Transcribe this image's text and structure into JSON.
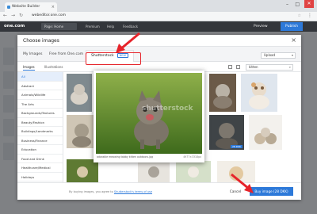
{
  "browser": {
    "tab_title": "Website Builder",
    "tab_close": "×",
    "url": "webeditor.one.com",
    "win_min": "–",
    "win_max": "□",
    "win_close": "✕",
    "back": "←",
    "forward": "→",
    "reload": "↻",
    "star": "☆",
    "menu": "⋮"
  },
  "appbar": {
    "logo": "one.com",
    "page": "Page: Home",
    "premium": "Premium",
    "help": "Help",
    "feedback": "Feedback",
    "preview": "Preview",
    "publish": "Publish"
  },
  "modal": {
    "title": "Choose images",
    "close": "×",
    "source_tabs": [
      "My Images",
      "Free from One.com",
      "Shutterstock"
    ],
    "new_badge": "NEW",
    "upload_select": "Upload",
    "sub_tabs": [
      "Images",
      "Illustrations"
    ],
    "search_value": "kitten",
    "search_icon": "⌕",
    "categories": [
      "All",
      "Abstract",
      "Animals/Wildlife",
      "The Arts",
      "Backgrounds/Textures",
      "Beauty/Fashion",
      "Buildings/Landmarks",
      "Business/Finance",
      "Education",
      "Food and Drink",
      "Healthcare/Medical",
      "Holidays"
    ],
    "active_category": "All",
    "price_badge": "28 DKK",
    "preview": {
      "watermark": "shutterstock",
      "caption": "adorable meowing tabby kitten outdoors.jpg",
      "dims": "4977×3318px"
    },
    "footer": {
      "terms_prefix": "By buying images, you agree to",
      "terms_link": "Shutterstock's terms of use",
      "cancel": "Cancel",
      "buy": "Buy image (28 DKK)"
    }
  },
  "colors": {
    "accent": "#2d79d9",
    "highlight": "#e6232a",
    "toolbar": "#33363b"
  }
}
